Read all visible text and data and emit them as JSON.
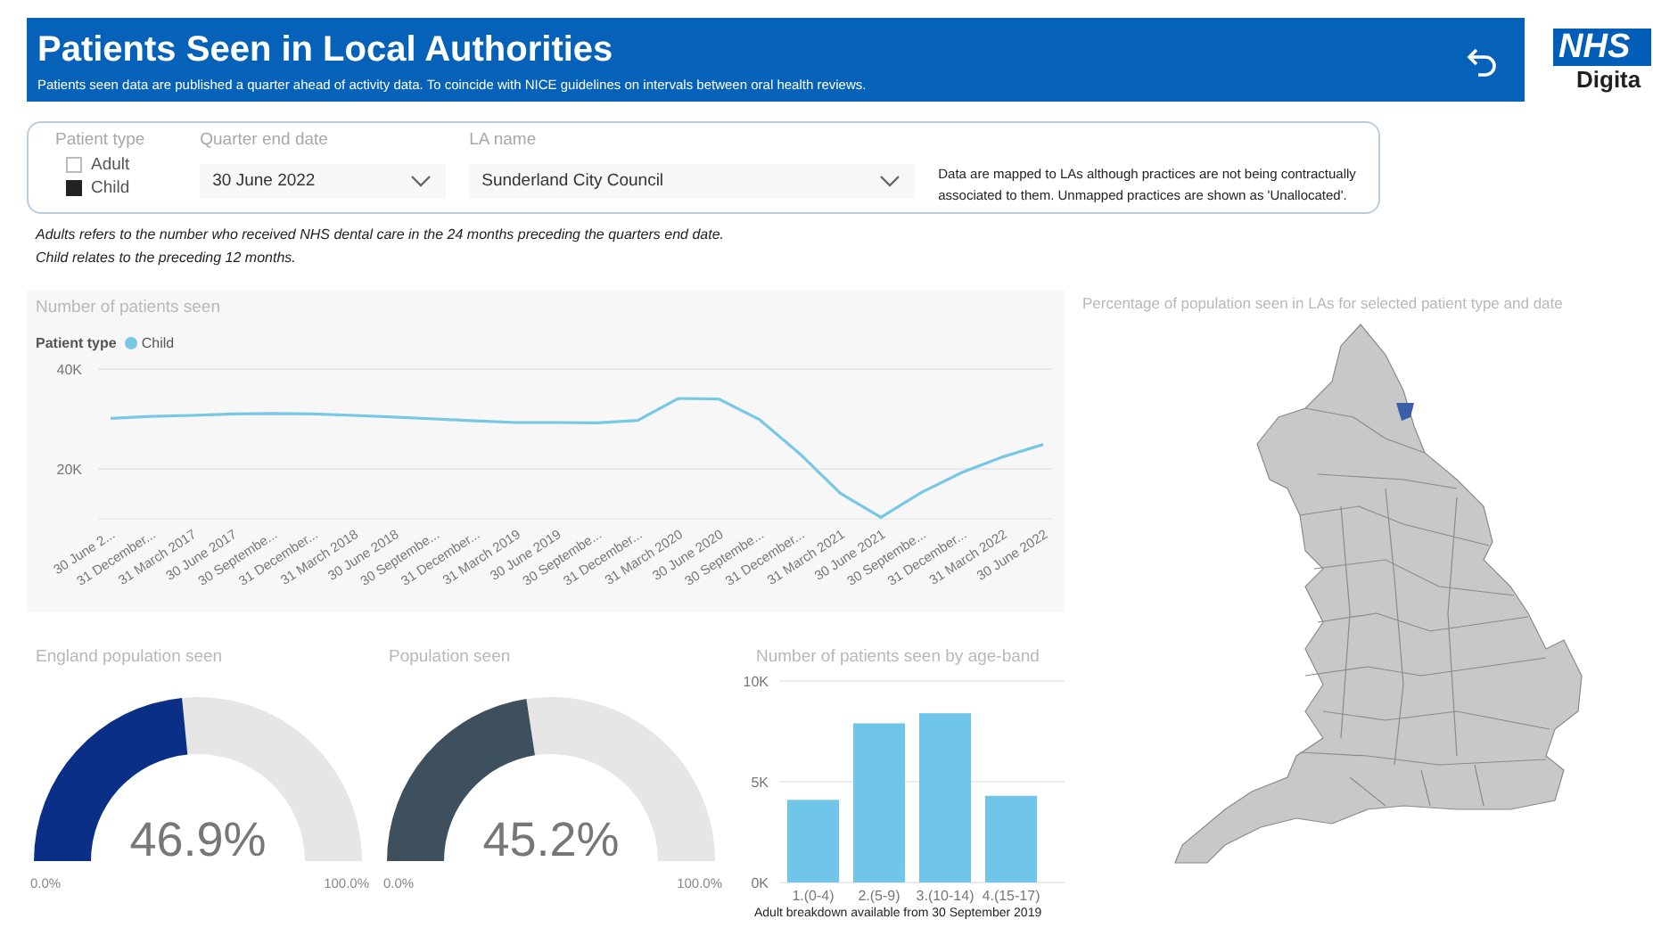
{
  "header": {
    "title": "Patients Seen in Local Authorities",
    "subtitle": "Patients seen data are published a quarter ahead of activity data. To coincide with NICE guidelines on intervals between oral health reviews."
  },
  "logo": {
    "mark": "NHS",
    "word": "Digita"
  },
  "filters": {
    "patient_type": {
      "label": "Patient type",
      "options": [
        {
          "label": "Adult",
          "checked": false
        },
        {
          "label": "Child",
          "checked": true
        }
      ]
    },
    "quarter": {
      "label": "Quarter end date",
      "value": "30 June 2022"
    },
    "la": {
      "label": "LA name",
      "value": "Sunderland City Council"
    },
    "note": "Data are mapped to LAs although practices are not being contractually associated to them. Unmapped practices are shown as 'Unallocated'."
  },
  "notes": [
    "Adults refers to the number who received NHS dental care in the 24 months preceding the quarters end date.",
    "Child relates to the preceding 12 months."
  ],
  "line_panel": {
    "legend_title": "Patient type",
    "chart_data": {
      "type": "line",
      "title": "Number of patients seen",
      "categories": [
        "30 June 2...",
        "31 December...",
        "31 March 2017",
        "30 June 2017",
        "30 Septembe...",
        "31 December...",
        "31 March 2018",
        "30 June 2018",
        "30 Septembe...",
        "31 December...",
        "31 March 2019",
        "30 June 2019",
        "30 Septembe...",
        "31 December...",
        "31 March 2020",
        "30 June 2020",
        "30 Septembe...",
        "31 December...",
        "31 March 2021",
        "30 June 2021",
        "30 Septembe...",
        "31 December...",
        "31 March 2022",
        "30 June 2022"
      ],
      "ylim": [
        10000,
        40000
      ],
      "series": [
        {
          "name": "Child",
          "color": "#77c8e4",
          "values": [
            30100,
            30500,
            30700,
            31000,
            31100,
            31000,
            30700,
            30400,
            30000,
            29600,
            29300,
            29300,
            29200,
            29700,
            34100,
            34000,
            29900,
            23000,
            15100,
            10300,
            15300,
            19300,
            22400,
            24900
          ]
        }
      ],
      "yticks": [
        {
          "value": 20000,
          "label": "20K"
        },
        {
          "value": 40000,
          "label": "40K"
        }
      ]
    }
  },
  "gauges": [
    {
      "title": "England population seen",
      "value": "46.9%",
      "min": "0.0%",
      "max": "100.0%",
      "color": "#0a2f87"
    },
    {
      "title": "Population seen",
      "value": "45.2%",
      "min": "0.0%",
      "max": "100.0%",
      "color": "#3e505e"
    }
  ],
  "bar_panel": {
    "footnote": "Adult breakdown available from 30 September 2019",
    "chart_data": {
      "type": "bar",
      "title": "Number of patients seen by age-band",
      "categories": [
        "1.(0-4)",
        "2.(5-9)",
        "3.(10-14)",
        "4.(15-17)"
      ],
      "series": [
        {
          "color": "#6fc6ea",
          "values": [
            4100,
            7900,
            8400,
            4300
          ]
        }
      ],
      "ylim": [
        0,
        10000
      ],
      "yticks": [
        {
          "value": 0,
          "label": "0K"
        },
        {
          "value": 5000,
          "label": "5K"
        },
        {
          "value": 10000,
          "label": "10K"
        }
      ]
    }
  },
  "map": {
    "title": "Percentage of population seen in LAs for selected patient type and date"
  }
}
